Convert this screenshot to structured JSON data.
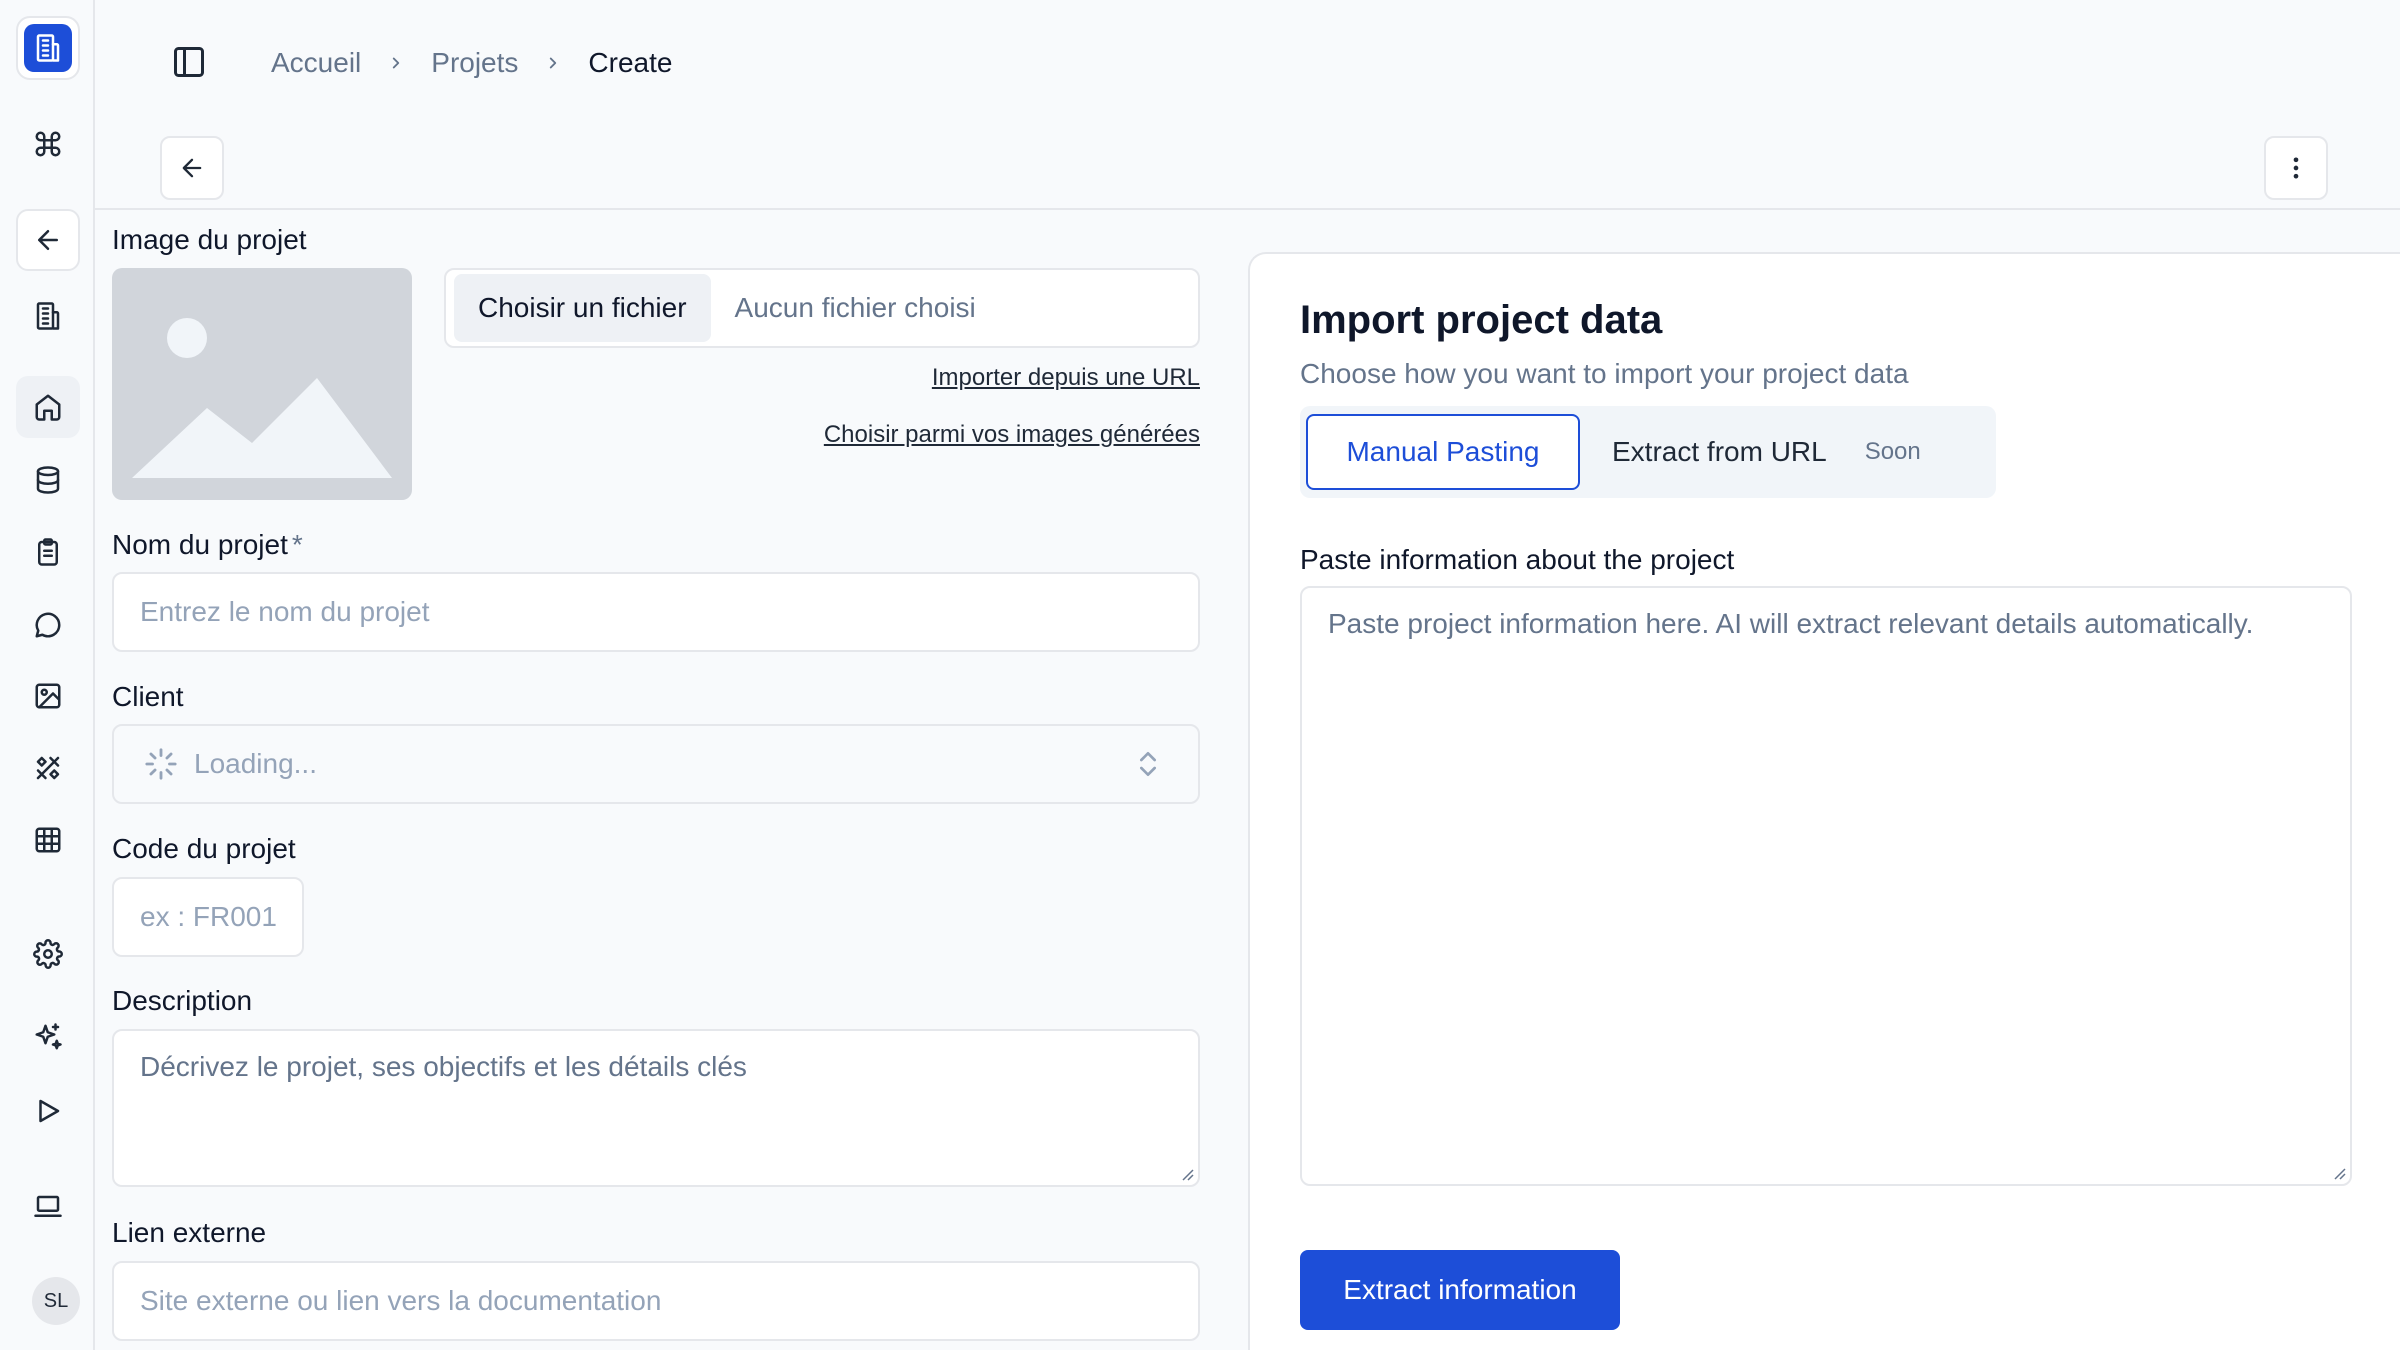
{
  "sidebar": {
    "avatar_initials": "SL",
    "accent_color": "#1d4ed8",
    "items": [
      {
        "icon": "building-icon"
      },
      {
        "icon": "command-icon"
      },
      {
        "icon": "arrow-left-icon"
      },
      {
        "icon": "building-icon"
      },
      {
        "icon": "home-icon"
      },
      {
        "icon": "database-icon"
      },
      {
        "icon": "clipboard-icon"
      },
      {
        "icon": "chat-icon"
      },
      {
        "icon": "image-icon"
      },
      {
        "icon": "tools-icon"
      },
      {
        "icon": "grid-icon"
      },
      {
        "icon": "gear-icon"
      },
      {
        "icon": "sparkles-icon"
      },
      {
        "icon": "play-icon"
      },
      {
        "icon": "laptop-icon"
      }
    ]
  },
  "header": {
    "breadcrumb": [
      "Accueil",
      "Projets",
      "Create"
    ]
  },
  "form": {
    "image_label": "Image du projet",
    "file_button": "Choisir un fichier",
    "file_status": "Aucun fichier choisi",
    "import_url_link": "Importer depuis une URL",
    "generated_images_link": "Choisir parmi vos images générées",
    "name_label": "Nom du projet",
    "name_required": "*",
    "name_placeholder": "Entrez le nom du projet",
    "client_label": "Client",
    "client_value": "Loading...",
    "code_label": "Code du projet",
    "code_placeholder": "ex : FR001",
    "description_label": "Description",
    "description_placeholder": "Décrivez le projet, ses objectifs et les détails clés",
    "link_label": "Lien externe",
    "link_placeholder": "Site externe ou lien vers la documentation"
  },
  "import_panel": {
    "title": "Import project data",
    "subtitle": "Choose how you want to import your project data",
    "tabs": [
      {
        "label": "Manual Pasting",
        "active": true
      },
      {
        "label": "Extract from URL",
        "active": false,
        "badge": "Soon"
      }
    ],
    "paste_label": "Paste information about the project",
    "paste_placeholder": "Paste project information here. AI will extract relevant details automatically.",
    "extract_button": "Extract information"
  }
}
